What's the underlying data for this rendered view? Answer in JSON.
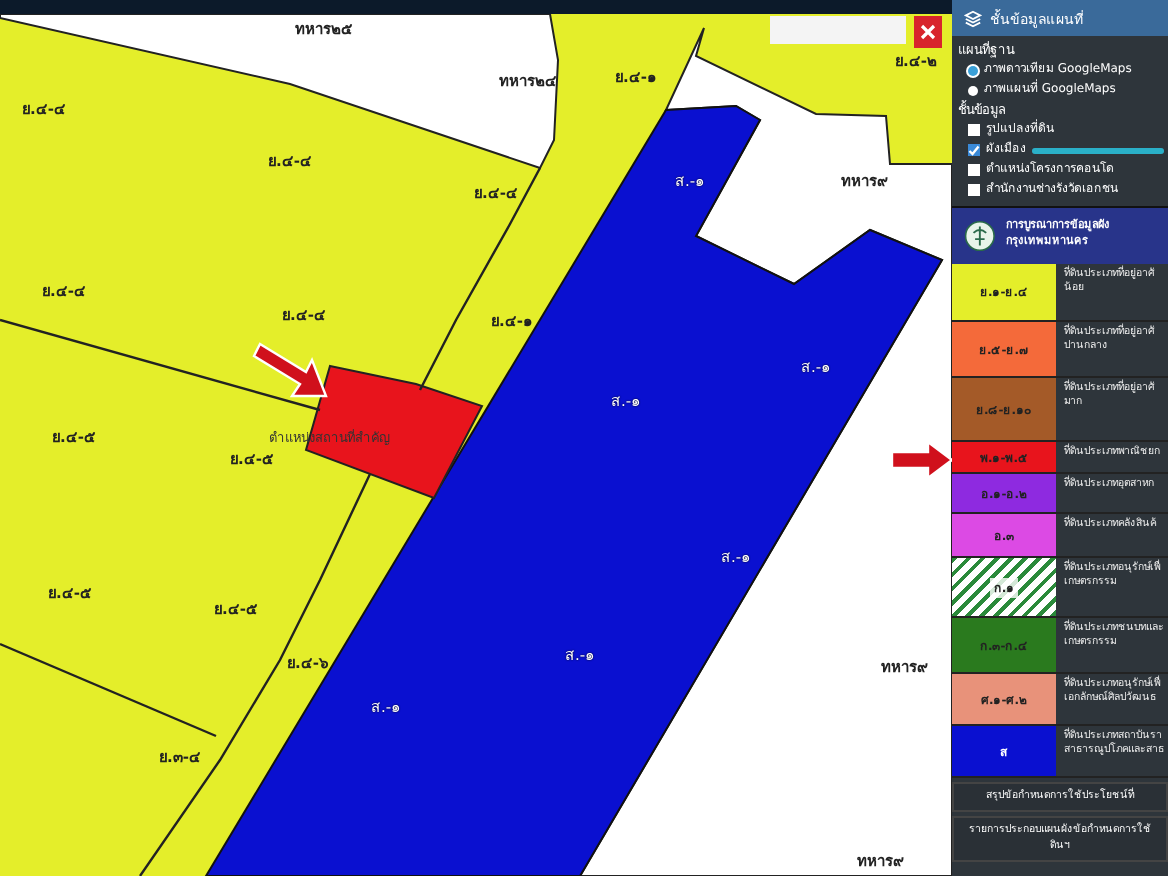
{
  "map": {
    "labels": [
      {
        "text": "ทหาร๒๕",
        "kind": "plain"
      },
      {
        "text": "ทหาร๒๔",
        "kind": "plain"
      },
      {
        "text": "ย.๔-๑",
        "kind": "plain"
      },
      {
        "text": "ย.๔-๒",
        "kind": "plain"
      },
      {
        "text": "ย.๔-๔",
        "kind": "plain"
      },
      {
        "text": "ส.-๑",
        "kind": "outline"
      },
      {
        "text": "ทหาร๙",
        "kind": "plain"
      },
      {
        "text": "ย.๔-๔",
        "kind": "plain"
      },
      {
        "text": "ย.๔-๔",
        "kind": "plain"
      },
      {
        "text": "ย.๔-๔",
        "kind": "plain"
      },
      {
        "text": "ย.๔-๔",
        "kind": "plain"
      },
      {
        "text": "ย.๔-๑",
        "kind": "plain"
      },
      {
        "text": "ส.-๑",
        "kind": "outline"
      },
      {
        "text": "ส.-๑",
        "kind": "outline"
      },
      {
        "text": "ย.๔-๕",
        "kind": "plain"
      },
      {
        "text": "ตำแหน่งสถานที่สำคัญ",
        "kind": "place"
      },
      {
        "text": "ย.๔-๕",
        "kind": "plain"
      },
      {
        "text": "ส.-๑",
        "kind": "outline"
      },
      {
        "text": "ย.๔-๕",
        "kind": "plain"
      },
      {
        "text": "ย.๔-๕",
        "kind": "plain"
      },
      {
        "text": "ย.๔-๖",
        "kind": "plain"
      },
      {
        "text": "ส.-๑",
        "kind": "outline"
      },
      {
        "text": "ส.-๑",
        "kind": "outline"
      },
      {
        "text": "ย.๓-๔",
        "kind": "plain"
      },
      {
        "text": "ทหาร๙",
        "kind": "plain"
      },
      {
        "text": "ทหาร๙",
        "kind": "plain"
      }
    ]
  },
  "sidebar": {
    "title": "ชั้นข้อมูลแผนที่",
    "base_map": {
      "heading": "แผนที่ฐาน",
      "options": [
        {
          "label": "ภาพดาวเทียม GoogleMaps",
          "selected": true
        },
        {
          "label": "ภาพแผนที่ GoogleMaps",
          "selected": false
        }
      ]
    },
    "layers": {
      "heading": "ชั้นข้อมูล",
      "items": [
        {
          "label": "รูปแปลงที่ดิน",
          "checked": false
        },
        {
          "label": "ผังเมือง",
          "checked": true,
          "level": 1
        },
        {
          "label": "ตำแหน่งโครงการคอนโด",
          "checked": false
        },
        {
          "label": "สำนักงานช่างรังวัดเอกชน",
          "checked": false
        }
      ]
    },
    "legend": {
      "title": "การบูรณาการข้อมูลผัง กรุงเทพมหานคร",
      "rows": [
        {
          "code": "ย.๑-ย.๔",
          "color": "#e4ee2a",
          "description": "ที่ดินประเภทที่อยู่อาศั น้อย"
        },
        {
          "code": "ย.๕-ย.๗",
          "color": "#f46a3a",
          "description": "ที่ดินประเภทที่อยู่อาศั ปานกลาง"
        },
        {
          "code": "ย.๘-ย.๑๐",
          "color": "#a45a28",
          "description": "ที่ดินประเภทที่อยู่อาศั มาก"
        },
        {
          "code": "พ.๑-พ.๕",
          "color": "#e8141c",
          "description": "ที่ดินประเภทพาณิชยก"
        },
        {
          "code": "อ.๑-อ.๒",
          "color": "#8e2ae0",
          "description": "ที่ดินประเภทอุตสาหก"
        },
        {
          "code": "อ.๓",
          "color": "#dc4ae4",
          "description": "ที่ดินประเภทคลังสินค้"
        },
        {
          "code": "ก.๑",
          "color": "#2a8a3a",
          "hatched": true,
          "description": "ที่ดินประเภทอนุรักษ์เพื่ เกษตรกรรม"
        },
        {
          "code": "ก.๓-ก.๔",
          "color": "#2a7a1e",
          "description": "ที่ดินประเภทชนบทและ เกษตรกรรม"
        },
        {
          "code": "ศ.๑-ศ.๒",
          "color": "#e8927a",
          "description": "ที่ดินประเภทอนุรักษ์เพื่ เอกลักษณ์ศิลปวัฒนธ"
        },
        {
          "code": "ส",
          "color": "#0a10d0",
          "description": "ที่ดินประเภทสถาบันรา สาธารณูปโภคและสาธ"
        }
      ]
    },
    "buttons": [
      "สรุปข้อกำหนดการใช้ประโยชน์ที่",
      "รายการประกอบแผนผังข้อกำหนดการใช้ ดินฯ"
    ]
  }
}
